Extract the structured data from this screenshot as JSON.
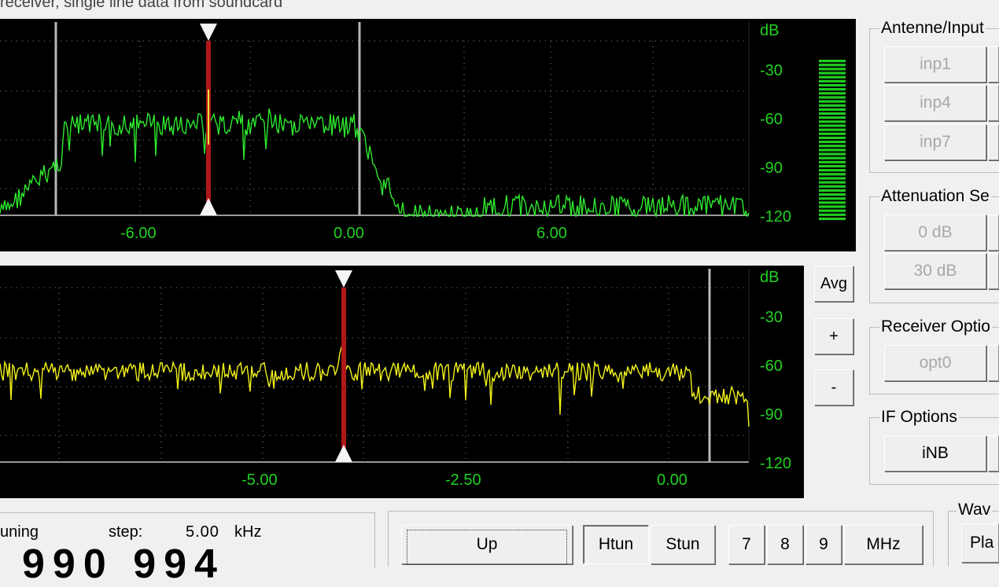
{
  "window": {
    "title": "receiver, single line data from soundcard"
  },
  "spectrum_top": {
    "db_labels": [
      "dB",
      "-30",
      "-60",
      "-90",
      "-120"
    ],
    "freq_labels": [
      "-6.00",
      "0.00",
      "6.00"
    ]
  },
  "spectrum_bottom": {
    "db_labels": [
      "dB",
      "-30",
      "-60",
      "-90",
      "-120"
    ],
    "freq_labels": [
      "-5.00",
      "-2.50",
      "0.00"
    ]
  },
  "side_controls": {
    "avg_label": "Avg",
    "plus_label": "+",
    "minus_label": "-"
  },
  "groups": {
    "antenne": {
      "title": "Antenne/Input",
      "buttons": [
        "inp1",
        "inp4",
        "inp7"
      ]
    },
    "attenuation": {
      "title": "Attenuation Se",
      "buttons": [
        "0 dB",
        "30 dB"
      ]
    },
    "receiver_options": {
      "title": "Receiver Optio",
      "buttons": [
        "opt0"
      ]
    },
    "if_options": {
      "title": "IF Options",
      "buttons": [
        "iNB"
      ]
    },
    "wave": {
      "title": "Wav",
      "buttons": [
        "Pla"
      ]
    }
  },
  "tuning": {
    "label": "uning",
    "step_label": "step:",
    "step_value": "5.00",
    "step_unit": "kHz",
    "digits": "990 994"
  },
  "keypad": {
    "up_label": "Up",
    "htun_label": "Htun",
    "stun_label": "Stun",
    "digits": [
      "7",
      "8",
      "9"
    ],
    "mhz_label": "MHz"
  },
  "colors": {
    "trace_top": "#2ee82e",
    "trace_bottom": "#f2f21a",
    "marker": "#b01818",
    "label_green": "#22d022",
    "meter": "#22cc22"
  }
}
